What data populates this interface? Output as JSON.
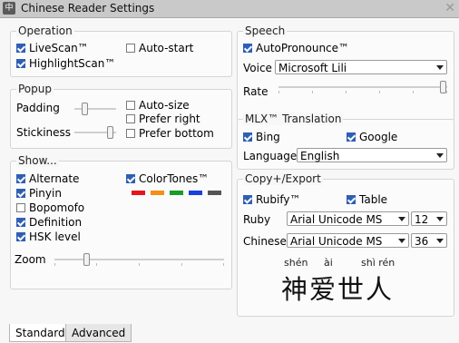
{
  "window": {
    "title": "Chinese Reader Settings",
    "icon_text": "中",
    "close": "✕"
  },
  "operation": {
    "title": "Operation",
    "livescan": {
      "label": "LiveScan™",
      "checked": true
    },
    "autostart": {
      "label": "Auto-start",
      "checked": false
    },
    "highlightscan": {
      "label": "HighlightScan™",
      "checked": true
    }
  },
  "popup": {
    "title": "Popup",
    "padding_label": "Padding",
    "stickiness_label": "Stickiness",
    "autosize": {
      "label": "Auto-size",
      "checked": false
    },
    "prefer_right": {
      "label": "Prefer right",
      "checked": false
    },
    "prefer_bottom": {
      "label": "Prefer bottom",
      "checked": false
    }
  },
  "show": {
    "title": "Show...",
    "alternate": {
      "label": "Alternate",
      "checked": true
    },
    "pinyin": {
      "label": "Pinyin",
      "checked": true
    },
    "bopomofo": {
      "label": "Bopomofo",
      "checked": false
    },
    "definition": {
      "label": "Definition",
      "checked": true
    },
    "hsk": {
      "label": "HSK level",
      "checked": true
    },
    "colortones": {
      "label": "ColorTones™",
      "checked": true
    },
    "tone_colors": [
      "#e8141c",
      "#f39015",
      "#1d9a2b",
      "#1740e0",
      "#555555"
    ],
    "zoom_label": "Zoom"
  },
  "speech": {
    "title": "Speech",
    "autopronounce": {
      "label": "AutoPronounce™",
      "checked": true
    },
    "voice_label": "Voice",
    "voice_value": "Microsoft Lili",
    "rate_label": "Rate"
  },
  "mlx": {
    "title": "MLX™ Translation",
    "bing": {
      "label": "Bing",
      "checked": true
    },
    "google": {
      "label": "Google",
      "checked": true
    },
    "language_label": "Language",
    "language_value": "English"
  },
  "copy": {
    "title": "Copy+/Export",
    "rubify": {
      "label": "Rubify™",
      "checked": true
    },
    "table": {
      "label": "Table",
      "checked": true
    },
    "ruby_label": "Ruby",
    "ruby_font": "Arial Unicode MS",
    "ruby_size": "12",
    "chinese_label": "Chinese",
    "chinese_font": "Arial Unicode MS",
    "chinese_size": "36",
    "preview_pinyin": [
      "shén",
      "ài",
      "shì rén"
    ],
    "preview_hanzi": "神爱世人"
  },
  "tabs": [
    "Standard",
    "Advanced"
  ]
}
